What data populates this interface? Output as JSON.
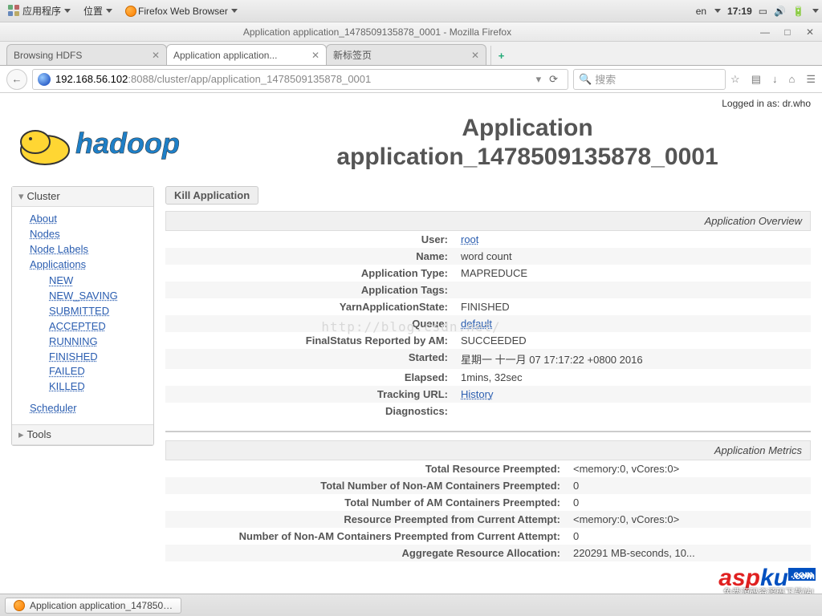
{
  "gnome": {
    "apps": "应用程序",
    "places": "位置",
    "app_label": "Firefox Web Browser",
    "lang": "en",
    "time": "17:19"
  },
  "window": {
    "title": "Application application_1478509135878_0001 - Mozilla Firefox"
  },
  "tabs": {
    "t0": "Browsing HDFS",
    "t1": "Application application...",
    "t2": "新标签页"
  },
  "url": {
    "host": "192.168.56.102",
    "port_path": ":8088/cluster/app/application_1478509135878_0001"
  },
  "search": {
    "placeholder": "搜索"
  },
  "login": {
    "text": "Logged in as: dr.who"
  },
  "title": {
    "line1": "Application",
    "line2": "application_1478509135878_0001"
  },
  "kill": {
    "label": "Kill Application"
  },
  "nav": {
    "cluster": "Cluster",
    "about": "About",
    "nodes": "Nodes",
    "node_labels": "Node Labels",
    "applications": "Applications",
    "new": "NEW",
    "new_saving": "NEW_SAVING",
    "submitted": "SUBMITTED",
    "accepted": "ACCEPTED",
    "running": "RUNNING",
    "finished": "FINISHED",
    "failed": "FAILED",
    "killed": "KILLED",
    "scheduler": "Scheduler",
    "tools": "Tools"
  },
  "overview": {
    "head": "Application Overview",
    "user_k": "User:",
    "user_v": "root",
    "name_k": "Name:",
    "name_v": "word count",
    "type_k": "Application Type:",
    "type_v": "MAPREDUCE",
    "tags_k": "Application Tags:",
    "tags_v": "",
    "state_k": "YarnApplicationState:",
    "state_v": "FINISHED",
    "queue_k": "Queue:",
    "queue_v": "default",
    "final_k": "FinalStatus Reported by AM:",
    "final_v": "SUCCEEDED",
    "started_k": "Started:",
    "started_v": "星期一 十一月 07 17:17:22 +0800 2016",
    "elapsed_k": "Elapsed:",
    "elapsed_v": "1mins, 32sec",
    "track_k": "Tracking URL:",
    "track_v": "History",
    "diag_k": "Diagnostics:",
    "diag_v": ""
  },
  "metrics": {
    "head": "Application Metrics",
    "r1k": "Total Resource Preempted:",
    "r1v": "<memory:0, vCores:0>",
    "r2k": "Total Number of Non-AM Containers Preempted:",
    "r2v": "0",
    "r3k": "Total Number of AM Containers Preempted:",
    "r3v": "0",
    "r4k": "Resource Preempted from Current Attempt:",
    "r4v": "<memory:0, vCores:0>",
    "r5k": "Number of Non-AM Containers Preempted from Current Attempt:",
    "r5v": "0",
    "r6k": "Aggregate Resource Allocation:",
    "r6v": "220291 MB-seconds, 10..."
  },
  "watermark": "http://blog.csdn.net/",
  "task": {
    "label": "Application application_147850…"
  },
  "brand": {
    "asp": "asp",
    "ku": "ku",
    "com": ".com",
    "sub": "免费源码资源码下载站!"
  }
}
